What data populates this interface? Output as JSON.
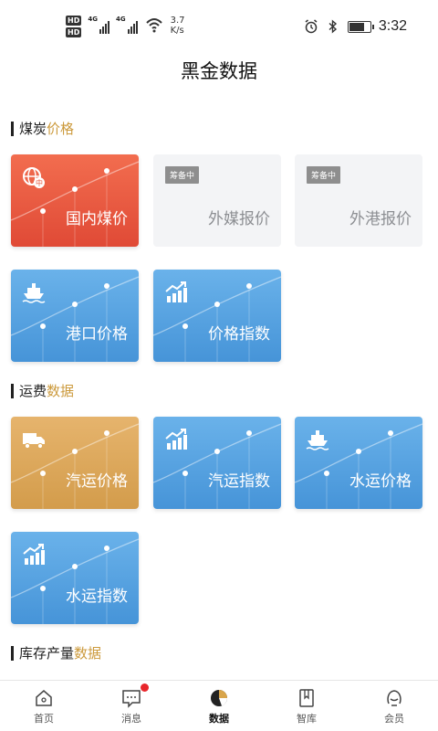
{
  "status_bar": {
    "hd1": "HD",
    "hd2": "HD",
    "net1": "4G",
    "net2": "4G",
    "speed_value": "3.7",
    "speed_unit": "K/s",
    "time": "3:32"
  },
  "header": {
    "title": "黑金数据"
  },
  "sections": [
    {
      "title_main": "煤炭",
      "title_accent": "价格",
      "cards": [
        {
          "label": "国内煤价",
          "style": "red",
          "icon": "globe-icon"
        },
        {
          "label": "外媒报价",
          "style": "grey",
          "badge": "筹备中"
        },
        {
          "label": "外港报价",
          "style": "grey",
          "badge": "筹备中"
        },
        {
          "label": "港口价格",
          "style": "blue",
          "icon": "ship-icon"
        },
        {
          "label": "价格指数",
          "style": "blue",
          "icon": "trend-icon"
        }
      ]
    },
    {
      "title_main": "运费",
      "title_accent": "数据",
      "cards": [
        {
          "label": "汽运价格",
          "style": "gold",
          "icon": "truck-icon"
        },
        {
          "label": "汽运指数",
          "style": "blue",
          "icon": "trend-icon"
        },
        {
          "label": "水运价格",
          "style": "blue",
          "icon": "ship-icon"
        },
        {
          "label": "水运指数",
          "style": "blue",
          "icon": "trend-icon"
        }
      ]
    },
    {
      "title_main": "库存产量",
      "title_accent": "数据"
    }
  ],
  "nav": [
    {
      "label": "首页",
      "icon": "home-icon"
    },
    {
      "label": "消息",
      "icon": "message-icon"
    },
    {
      "label": "数据",
      "icon": "data-icon",
      "active": true
    },
    {
      "label": "智库",
      "icon": "book-icon"
    },
    {
      "label": "会员",
      "icon": "member-icon"
    }
  ],
  "colors": {
    "accent": "#cc9a3c",
    "red_card": "#e85a41",
    "blue_card": "#5aa6e3",
    "gold_card": "#dfac5f",
    "badge_dot": "#e8262b"
  }
}
